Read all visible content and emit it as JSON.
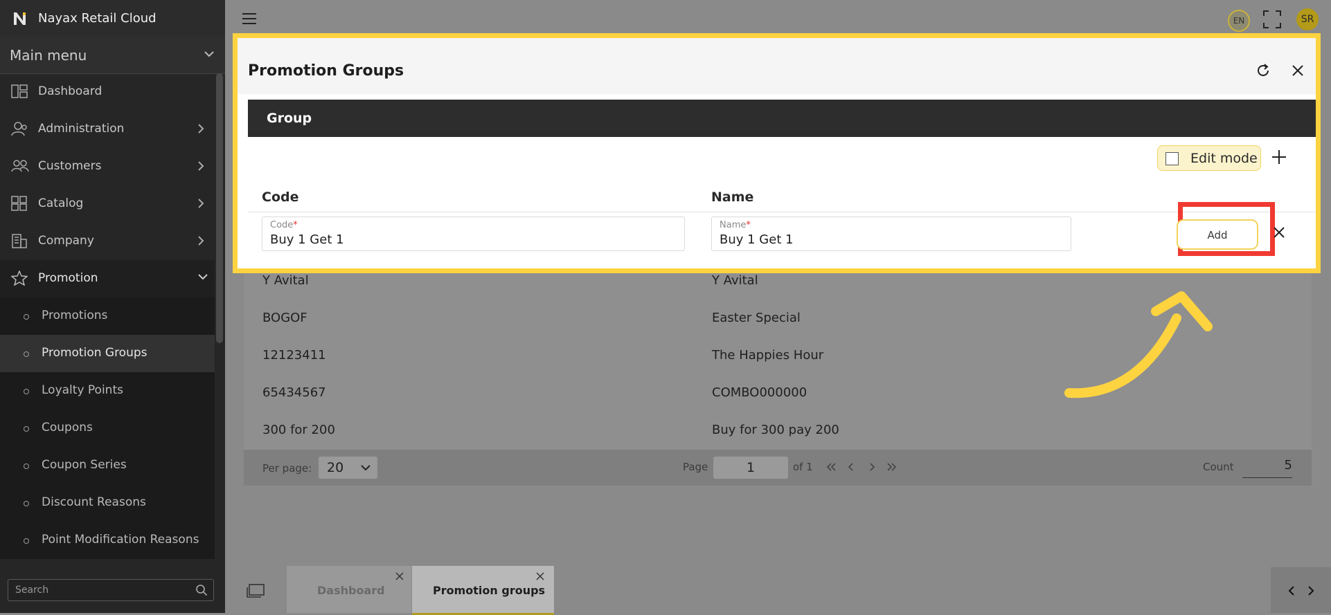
{
  "sidebar": {
    "brand": "Nayax Retail Cloud",
    "main_menu": "Main menu",
    "items": [
      {
        "label": "Dashboard"
      },
      {
        "label": "Administration"
      },
      {
        "label": "Customers"
      },
      {
        "label": "Catalog"
      },
      {
        "label": "Company"
      },
      {
        "label": "Promotion"
      }
    ],
    "promotion_sub": [
      {
        "label": "Promotions"
      },
      {
        "label": "Promotion Groups"
      },
      {
        "label": "Loyalty Points"
      },
      {
        "label": "Coupons"
      },
      {
        "label": "Coupon Series"
      },
      {
        "label": "Discount Reasons"
      },
      {
        "label": "Point Modification Reasons"
      }
    ],
    "search_placeholder": "Search"
  },
  "topbar": {
    "language": "EN",
    "avatar_initials": "SR"
  },
  "modal": {
    "title": "Promotion Groups",
    "section": "Group",
    "edit_mode_label": "Edit mode",
    "columns": {
      "code": "Code",
      "name": "Name"
    },
    "code_field": {
      "label": "Code",
      "required": "*",
      "value": "Buy 1 Get 1"
    },
    "name_field": {
      "label": "Name",
      "required": "*",
      "value": "Buy 1 Get 1"
    },
    "add_label": "Add"
  },
  "table": {
    "rows": [
      {
        "code": "Y Avital",
        "name": "Y Avital"
      },
      {
        "code": "BOGOF",
        "name": "Easter Special"
      },
      {
        "code": "12123411",
        "name": "The Happies Hour"
      },
      {
        "code": "65434567",
        "name": "COMBO000000"
      },
      {
        "code": "300 for 200",
        "name": "Buy for 300 pay 200"
      }
    ]
  },
  "pager": {
    "per_page_label": "Per page:",
    "per_page_value": "20",
    "page_label": "Page",
    "page_value": "1",
    "of_label": "of 1",
    "count_label": "Count",
    "count_value": "5"
  },
  "bottom_tabs": [
    {
      "label": "Dashboard"
    },
    {
      "label": "Promotion groups"
    }
  ],
  "colors": {
    "highlight_yellow": "#fdd340",
    "highlight_red": "#f03a31",
    "sidebar_bg": "#262626",
    "accent": "#b39a18"
  }
}
